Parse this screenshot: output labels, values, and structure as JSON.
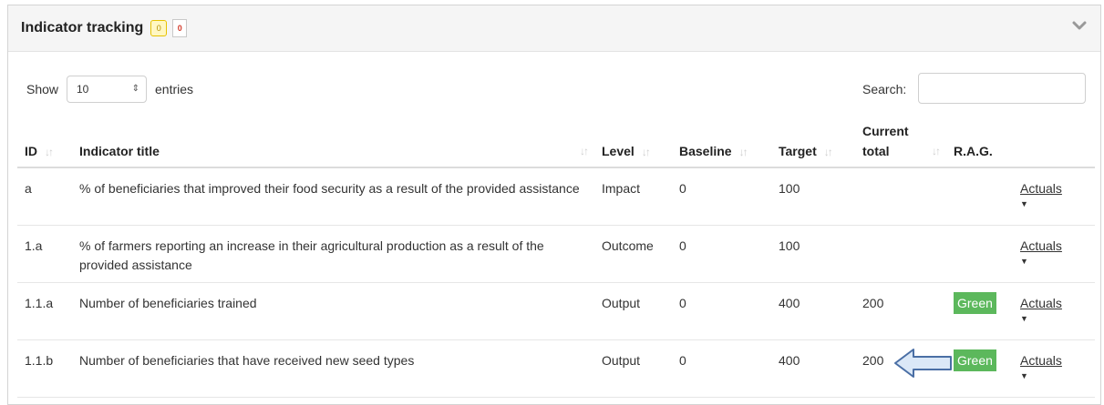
{
  "panel": {
    "title": "Indicator tracking",
    "badge_count": "0",
    "doc_badge": "0"
  },
  "toolbar": {
    "show_label": "Show",
    "entries_value": "10",
    "entries_label": "entries",
    "search_label": "Search:",
    "search_value": ""
  },
  "table": {
    "headers": {
      "id": "ID",
      "title": "Indicator title",
      "level": "Level",
      "baseline": "Baseline",
      "target": "Target",
      "current_line1": "Current",
      "current_line2": "total",
      "rag": "R.A.G."
    },
    "rows": [
      {
        "id": "a",
        "title": "% of beneficiaries that improved their food security as a result of the provided assistance",
        "level": "Impact",
        "baseline": "0",
        "target": "100",
        "current": "",
        "rag": "",
        "actuals": "Actuals"
      },
      {
        "id": "1.a",
        "title": "% of farmers reporting an increase in their agricultural production as a result of the provided assistance",
        "level": "Outcome",
        "baseline": "0",
        "target": "100",
        "current": "",
        "rag": "",
        "actuals": "Actuals"
      },
      {
        "id": "1.1.a",
        "title": "Number of beneficiaries trained",
        "level": "Output",
        "baseline": "0",
        "target": "400",
        "current": "200",
        "rag": "Green",
        "actuals": "Actuals"
      },
      {
        "id": "1.1.b",
        "title": "Number of beneficiaries that have received new seed types",
        "level": "Output",
        "baseline": "0",
        "target": "400",
        "current": "200",
        "rag": "Green",
        "actuals": "Actuals"
      }
    ]
  },
  "colors": {
    "rag_green": "#5cb85c",
    "arrow_fill": "#dbe8f7",
    "arrow_stroke": "#4a6fa5"
  }
}
